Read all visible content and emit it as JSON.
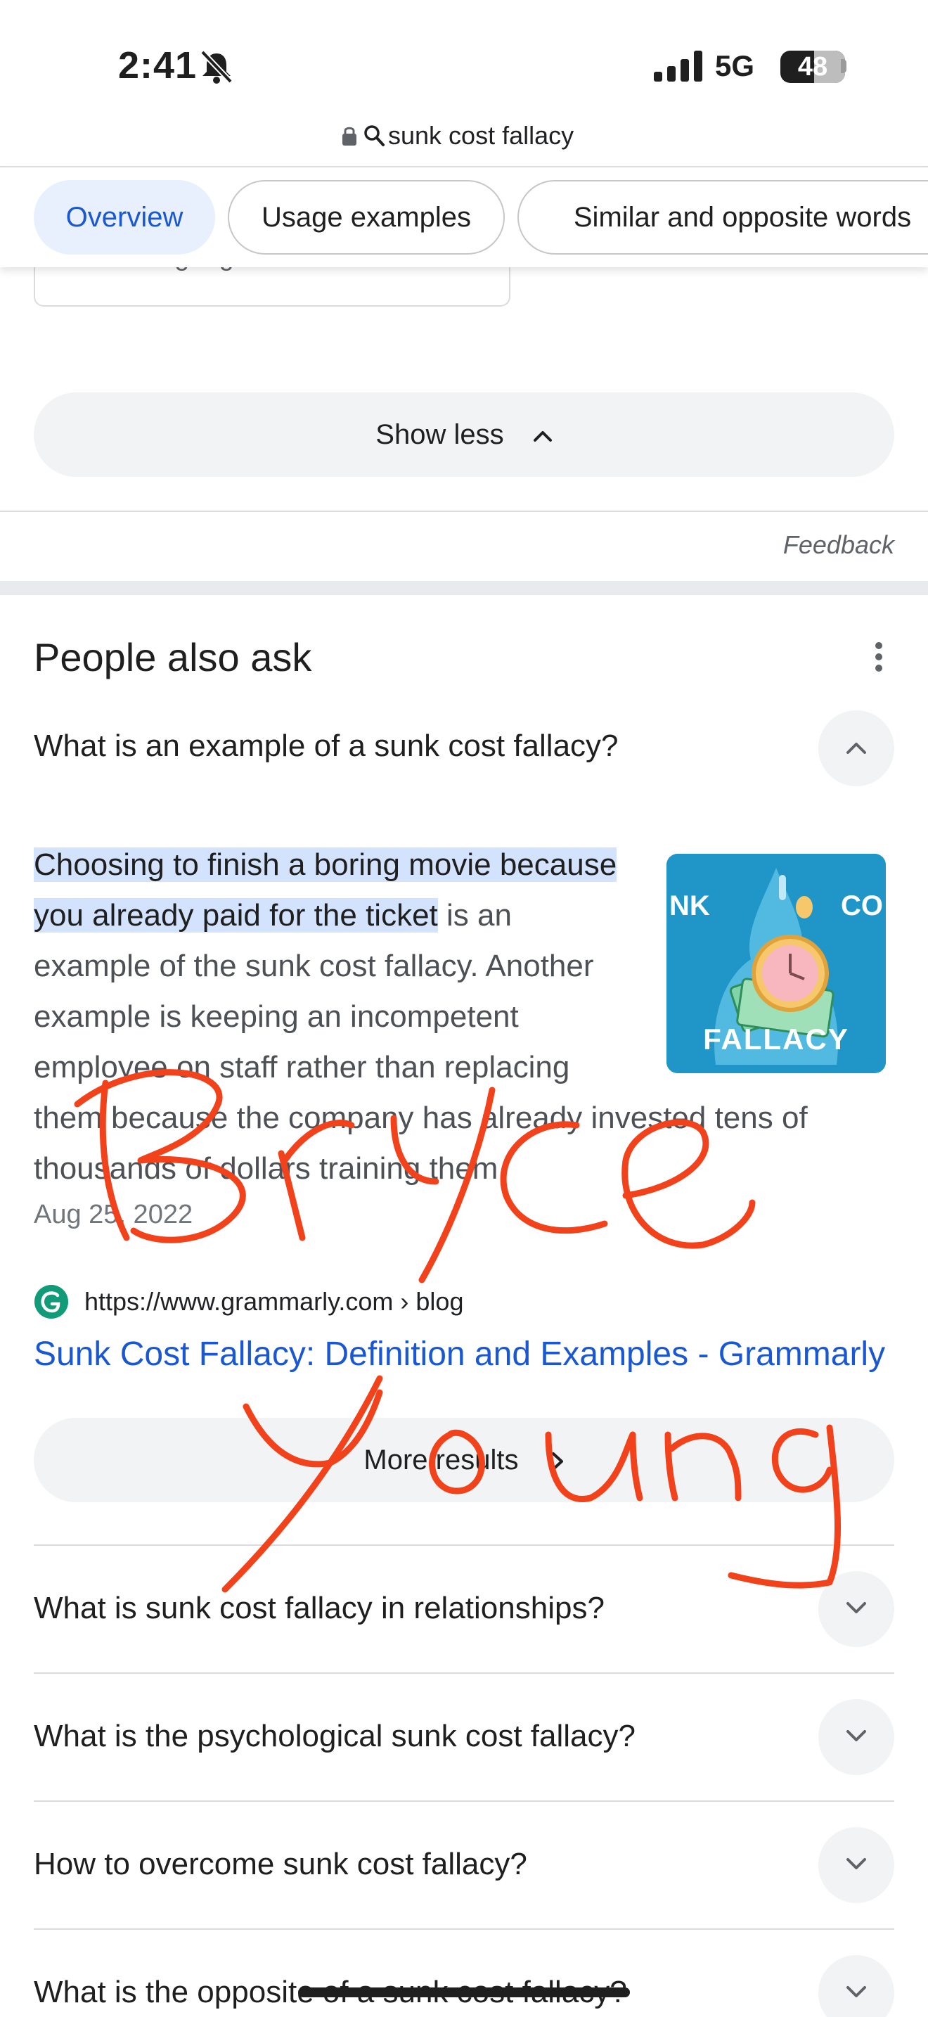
{
  "status_bar": {
    "time": "2:41",
    "network": "5G",
    "battery": "48"
  },
  "url_bar": {
    "query": "sunk cost fallacy"
  },
  "tabs": [
    {
      "label": "Overview",
      "active": true
    },
    {
      "label": "Usage examples",
      "active": false
    },
    {
      "label": "Similar and opposite words",
      "active": false
    }
  ],
  "language": {
    "label": "Choose language"
  },
  "show_less": {
    "label": "Show less"
  },
  "feedback": {
    "label": "Feedback"
  },
  "people_also_ask": {
    "title": "People also ask",
    "expanded": {
      "question": "What is an example of a sunk cost fallacy?",
      "answer_highlight": "Choosing to finish a boring movie because you already paid for the ticket",
      "answer_rest": " is an example of the sunk cost fallacy. Another example is keeping an incompetent employee on staff rather than replacing them because the company has already invested tens of thousands of dollars training them.",
      "image_text_left": "NK",
      "image_text_right": "CO",
      "image_text_bottom": "FALLACY",
      "date": "Aug 25, 2022",
      "source_url": "https://www.grammarly.com › blog",
      "source_title": "Sunk Cost Fallacy: Definition and Examples - Grammarly",
      "more_results": "More results"
    },
    "questions": [
      "What is sunk cost fallacy in relationships?",
      "What is the psychological sunk cost fallacy?",
      "How to overcome sunk cost fallacy?",
      "What is the opposite of a sunk cost fallacy?"
    ]
  },
  "handwriting": {
    "text": "Bryce Young",
    "color": "#f2421b"
  },
  "colors": {
    "accent": "#1a57d3",
    "chip_active_bg": "#e8f0fe",
    "highlight": "#d3e3fd"
  }
}
